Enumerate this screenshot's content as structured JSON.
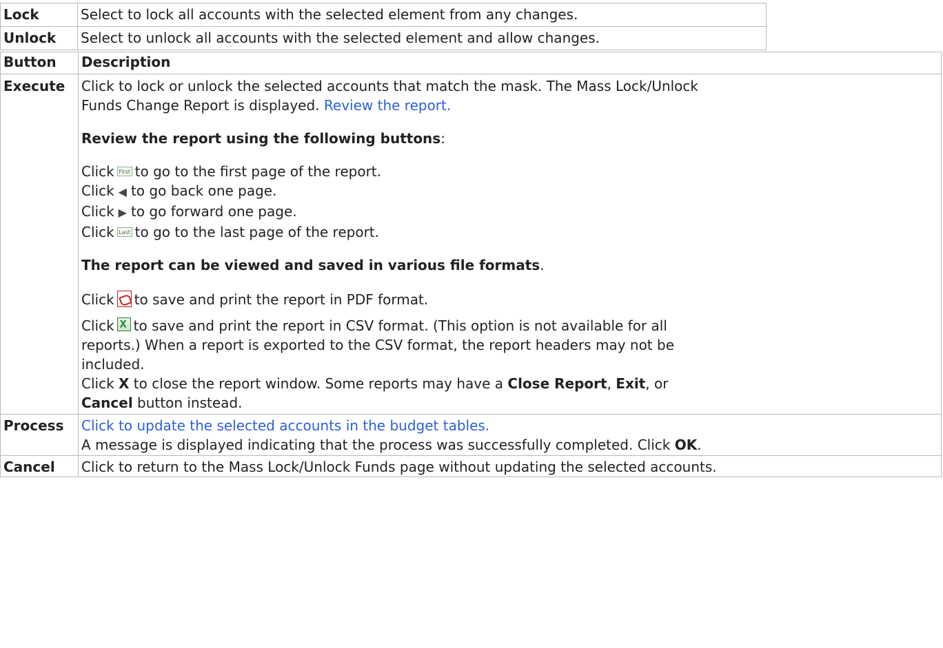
{
  "options": [
    {
      "label": "Lock",
      "desc": "Select to lock all accounts with the selected element from any changes."
    },
    {
      "label": "Unlock",
      "desc": "Select to unlock all accounts with the selected element and allow changes."
    }
  ],
  "buttons_table": {
    "header_button": "Button",
    "header_description": "Description",
    "execute": {
      "label": "Execute",
      "desc_line1": "Click to lock or unlock the selected accounts that match the mask. The Mass Lock/Unlock",
      "desc_line2": "Funds Change Report is displayed.",
      "review_link": "Review the report.",
      "review_heading": "Review the report using the following buttons",
      "review_heading_colon": ":",
      "nav_click": "Click",
      "nav_first_icon_text": "First",
      "nav_first_desc": "to go to the first page of the report.",
      "nav_back_desc": "to go back one page.",
      "nav_forward_desc": "to go forward one page.",
      "nav_last_icon_text": "Last",
      "nav_last_desc": "to go to the last page of the report.",
      "formats_heading": "The report can be viewed and saved in various file formats",
      "formats_heading_period": ".",
      "pdf_desc": "to save and print the report in PDF format.",
      "csv_desc_line1": "to save and print the report in CSV format. (This option is not available for all",
      "csv_desc_line2": "reports.) When a report is exported to the CSV format, the report headers may not be",
      "csv_desc_line3": "included.",
      "close_x": "X",
      "close_desc_a": "to close the report window. Some reports may have a",
      "close_report": "Close Report",
      "comma": ",",
      "exit": "Exit",
      "or_text": ", or",
      "cancel_bold": "Cancel",
      "close_desc_b": "button instead."
    },
    "process": {
      "label": "Process",
      "link": "Click to update the selected accounts in the budget tables.",
      "desc_a": "A message is displayed indicating that the process was successfully completed. Click",
      "ok": "OK",
      "period": "."
    },
    "cancel": {
      "label": "Cancel",
      "desc": "Click to return to the Mass Lock/Unlock Funds page without updating the selected accounts."
    }
  },
  "colors": {
    "link": "#2b5fd9",
    "border": "#b8b8b8",
    "text": "#222222"
  }
}
